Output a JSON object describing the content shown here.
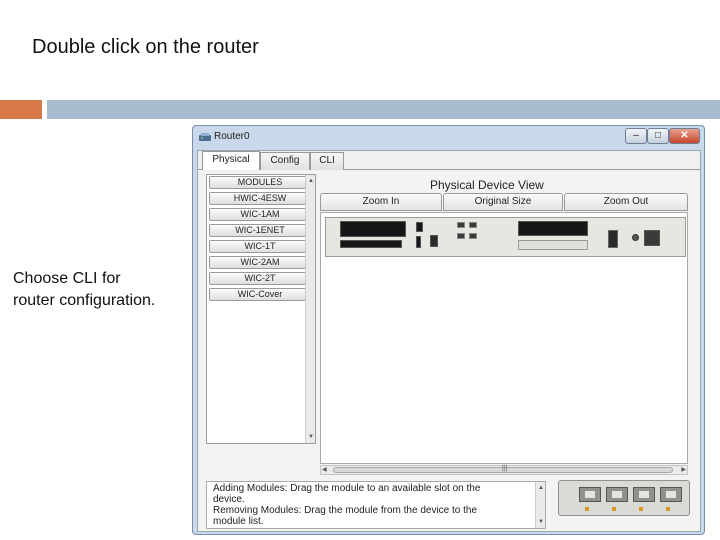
{
  "slide": {
    "title": "Double click on the router",
    "caption_line1": "Choose CLI for",
    "caption_line2": "router configuration."
  },
  "window": {
    "title": "Router0",
    "controls": {
      "minimize": "–",
      "maximize": "□",
      "close": "✕"
    }
  },
  "tabs": [
    {
      "label": "Physical",
      "active": true
    },
    {
      "label": "Config",
      "active": false
    },
    {
      "label": "CLI",
      "active": false
    }
  ],
  "modules": [
    "MODULES",
    "HWIC-4ESW",
    "WIC-1AM",
    "WIC-1ENET",
    "WIC-1T",
    "WIC-2AM",
    "WIC-2T",
    "WIC-Cover"
  ],
  "device_view": {
    "title": "Physical Device View",
    "zoom_in": "Zoom In",
    "original_size": "Original Size",
    "zoom_out": "Zoom Out"
  },
  "info_text": [
    "Adding Modules: Drag the module to an available slot on the",
    "device.",
    "Removing Modules: Drag the module from the device to the",
    "module list."
  ],
  "icons": {
    "app": "router-app-icon",
    "scroll_up": "▲",
    "scroll_down": "▼",
    "scroll_left": "◀",
    "scroll_right": "▶",
    "grip": "|||"
  },
  "colors": {
    "accent_orange": "#d87a48",
    "accent_blue": "#a9bccf",
    "window_frame": "#c9d8ea",
    "close_button": "#c6452b"
  }
}
